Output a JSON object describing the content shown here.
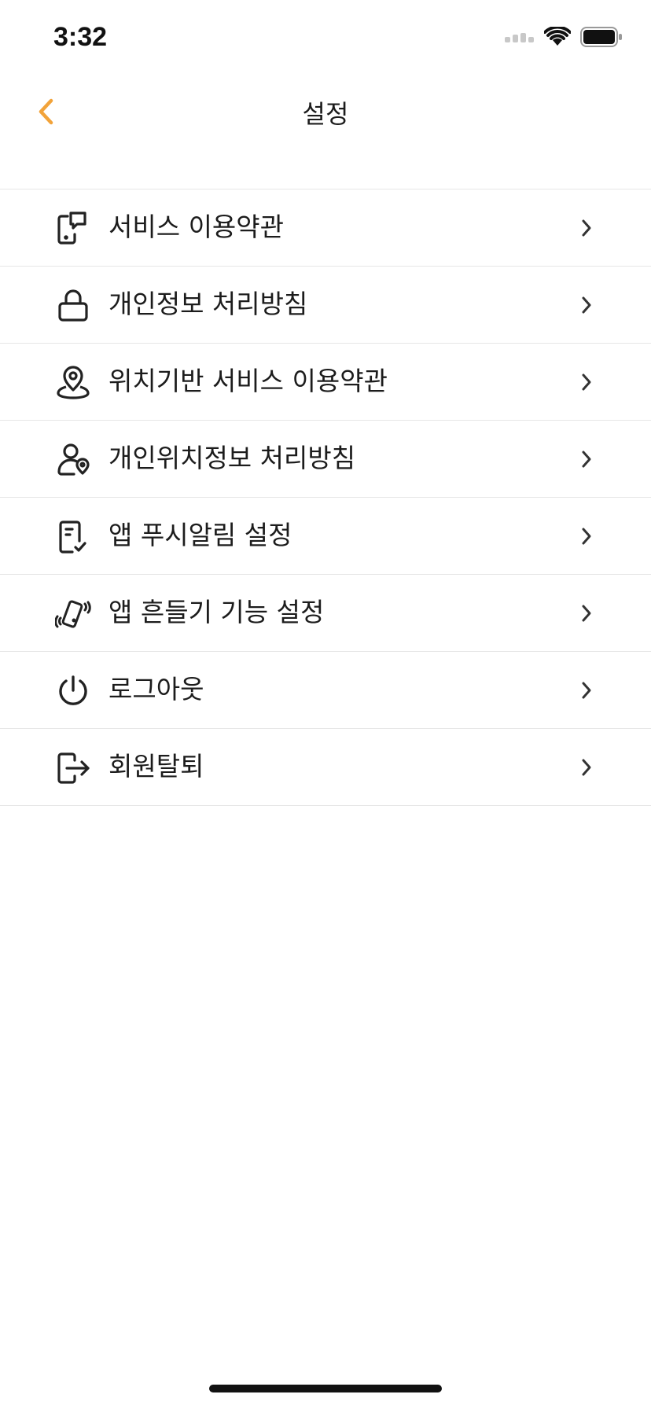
{
  "status_bar": {
    "time": "3:32",
    "icons": [
      "cellular-signal-icon",
      "wifi-icon",
      "battery-icon"
    ]
  },
  "nav": {
    "title": "설정",
    "back_icon": "chevron-left-icon",
    "accent_color": "#F2A33A"
  },
  "settings": {
    "items": [
      {
        "label": "서비스 이용약관",
        "icon": "phone-message-icon"
      },
      {
        "label": "개인정보 처리방침",
        "icon": "lock-icon"
      },
      {
        "label": "위치기반 서비스 이용약관",
        "icon": "location-pin-icon"
      },
      {
        "label": "개인위치정보 처리방침",
        "icon": "user-location-icon"
      },
      {
        "label": "앱 푸시알림 설정",
        "icon": "notification-check-icon"
      },
      {
        "label": "앱 흔들기 기능 설정",
        "icon": "phone-shake-icon"
      },
      {
        "label": "로그아웃",
        "icon": "power-icon"
      },
      {
        "label": "회원탈퇴",
        "icon": "logout-icon"
      }
    ],
    "chevron_icon": "chevron-right-icon"
  }
}
